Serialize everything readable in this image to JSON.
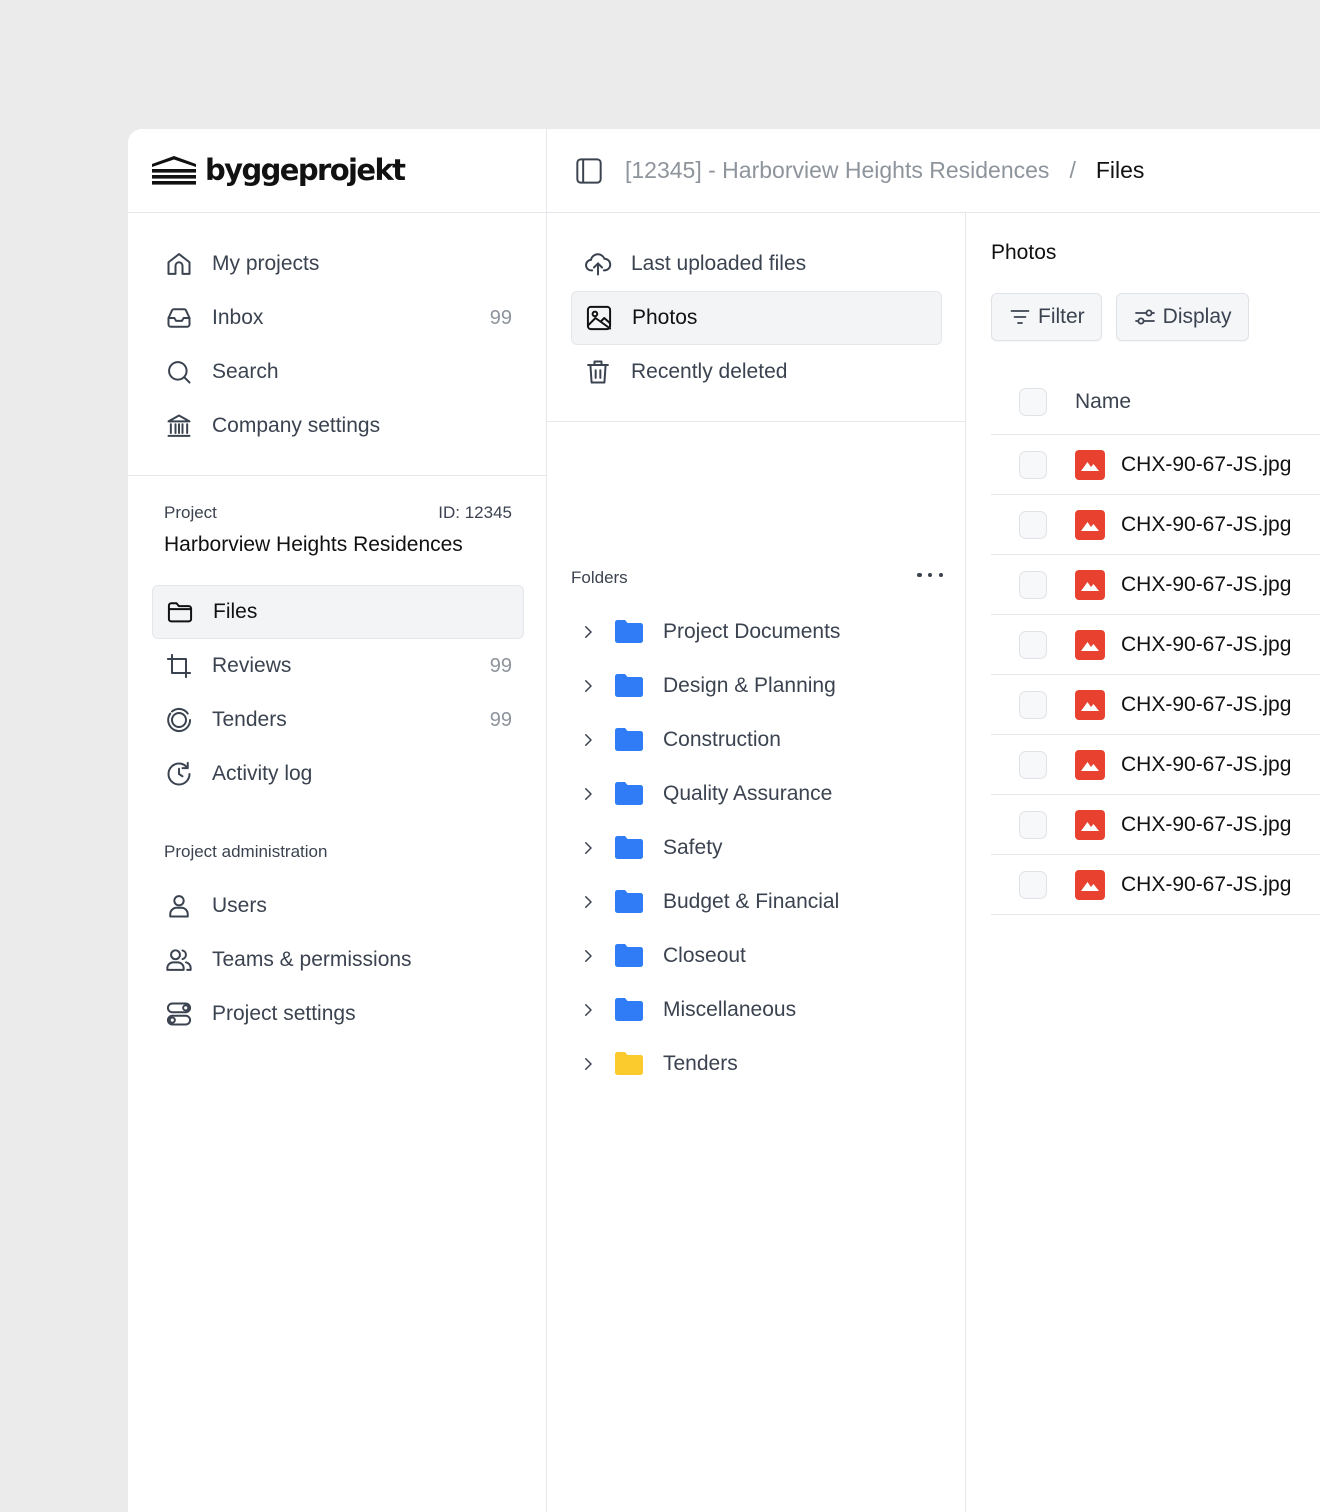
{
  "brand": {
    "name": "byggeprojekt"
  },
  "main_nav": [
    {
      "label": "My projects",
      "icon": "home-icon",
      "count": ""
    },
    {
      "label": "Inbox",
      "icon": "inbox-icon",
      "count": "99"
    },
    {
      "label": "Search",
      "icon": "search-icon",
      "count": ""
    },
    {
      "label": "Company settings",
      "icon": "bank-icon",
      "count": ""
    }
  ],
  "project": {
    "label": "Project",
    "id_label": "ID: 12345",
    "name": "Harborview Heights Residences"
  },
  "project_nav": [
    {
      "label": "Files",
      "icon": "folder-icon",
      "count": "",
      "active": true
    },
    {
      "label": "Reviews",
      "icon": "crop-icon",
      "count": "99"
    },
    {
      "label": "Tenders",
      "icon": "target-icon",
      "count": "99"
    },
    {
      "label": "Activity log",
      "icon": "clock-history-icon",
      "count": ""
    }
  ],
  "admin": {
    "label": "Project administration",
    "items": [
      {
        "label": "Users",
        "icon": "user-icon"
      },
      {
        "label": "Teams & permissions",
        "icon": "users-icon"
      },
      {
        "label": "Project settings",
        "icon": "toggles-icon"
      }
    ]
  },
  "breadcrumb": {
    "project": "[12345] - Harborview Heights Residences",
    "separator": "/",
    "current": "Files"
  },
  "file_views": [
    {
      "label": "Last uploaded files",
      "icon": "cloud-upload-icon"
    },
    {
      "label": "Photos",
      "icon": "image-icon",
      "active": true
    },
    {
      "label": "Recently deleted",
      "icon": "trash-icon"
    }
  ],
  "folders": {
    "label": "Folders",
    "items": [
      {
        "label": "Project Documents",
        "color": "#2f7cf6"
      },
      {
        "label": "Design & Planning",
        "color": "#2f7cf6"
      },
      {
        "label": "Construction",
        "color": "#2f7cf6"
      },
      {
        "label": "Quality Assurance",
        "color": "#2f7cf6"
      },
      {
        "label": "Safety",
        "color": "#2f7cf6"
      },
      {
        "label": "Budget & Financial",
        "color": "#2f7cf6"
      },
      {
        "label": "Closeout",
        "color": "#2f7cf6"
      },
      {
        "label": "Miscellaneous",
        "color": "#2f7cf6"
      },
      {
        "label": "Tenders",
        "color": "#fbcb2d"
      }
    ]
  },
  "photos": {
    "title": "Photos",
    "filter_label": "Filter",
    "display_label": "Display",
    "column_name": "Name",
    "files": [
      "CHX-90-67-JS.jpg",
      "CHX-90-67-JS.jpg",
      "CHX-90-67-JS.jpg",
      "CHX-90-67-JS.jpg",
      "CHX-90-67-JS.jpg",
      "CHX-90-67-JS.jpg",
      "CHX-90-67-JS.jpg",
      "CHX-90-67-JS.jpg"
    ],
    "file_icon_color": "#e8412f"
  }
}
